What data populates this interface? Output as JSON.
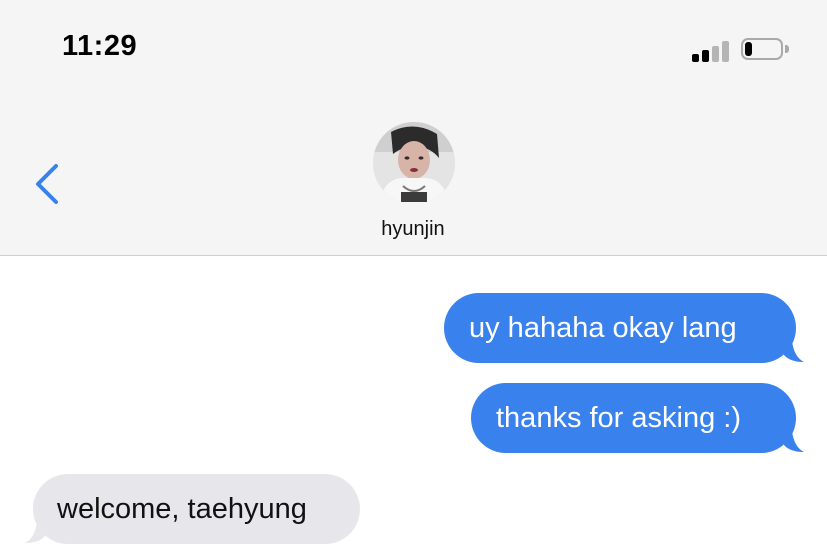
{
  "status_bar": {
    "time": "11:29",
    "signal_bars_active": 2,
    "signal_bars_total": 4,
    "battery_level": 0.2,
    "signal_icon": "cellular-signal-icon",
    "battery_icon": "battery-icon"
  },
  "header": {
    "back_icon": "chevron-left-icon",
    "contact_name": "hyunjin",
    "accent_color": "#3981ec"
  },
  "messages": [
    {
      "direction": "outgoing",
      "text": "uy hahaha okay lang"
    },
    {
      "direction": "outgoing",
      "text": "thanks for asking :)"
    },
    {
      "direction": "incoming",
      "text": "welcome, taehyung"
    }
  ],
  "colors": {
    "outgoing_bubble": "#3981ec",
    "incoming_bubble": "#e7e7eb",
    "header_bg": "#f5f5f5"
  }
}
